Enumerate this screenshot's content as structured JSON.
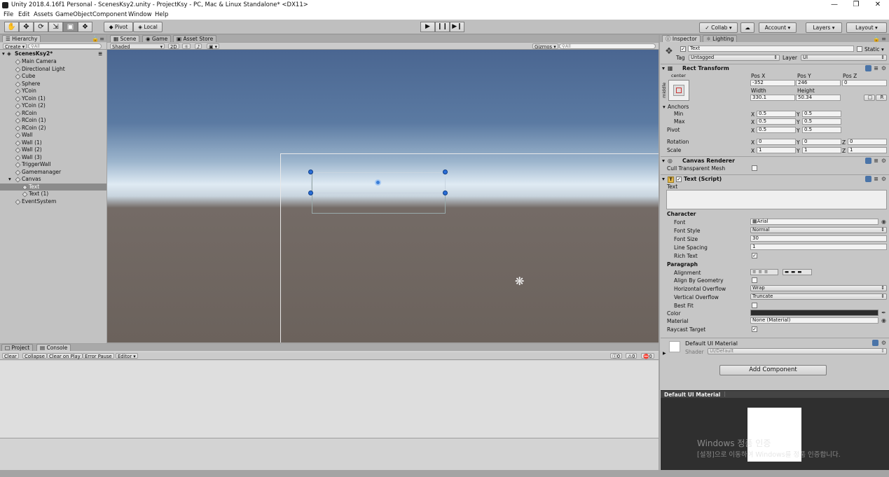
{
  "window": {
    "title": "Unity 2018.4.16f1 Personal - ScenesKsy2.unity - ProjectKsy - PC, Mac & Linux Standalone* <DX11>"
  },
  "menu": [
    "File",
    "Edit",
    "Assets",
    "GameObject",
    "Component",
    "Window",
    "Help"
  ],
  "toolbar": {
    "pivot": "Pivot",
    "local": "Local",
    "collab": "Collab",
    "account": "Account",
    "layers": "Layers",
    "layout": "Layout"
  },
  "hierarchy": {
    "tab": "Hierarchy",
    "create": "Create",
    "search_placeholder": "All",
    "scene": "ScenesKsy2*",
    "items": [
      "Main Camera",
      "Directional Light",
      "Cube",
      "Sphere",
      "YCoin",
      "YCoin (1)",
      "YCoin (2)",
      "RCoin",
      "RCoin (1)",
      "RCoin (2)",
      "Wall",
      "Wall (1)",
      "Wall (2)",
      "Wall (3)",
      "TriggerWall",
      "Gamemanager",
      "Canvas",
      "Text",
      "Text (1)",
      "EventSystem"
    ]
  },
  "scene_tabs": {
    "scene": "Scene",
    "game": "Game",
    "asset_store": "Asset Store",
    "shaded": "Shaded",
    "mode2d": "2D",
    "gizmos": "Gizmos",
    "search_placeholder": "All"
  },
  "console": {
    "project_tab": "Project",
    "console_tab": "Console",
    "clear": "Clear",
    "collapse": "Collapse",
    "clear_on_play": "Clear on Play",
    "error_pause": "Error Pause",
    "editor": "Editor",
    "count_info": "0",
    "count_warn": "0",
    "count_err": "0"
  },
  "inspector": {
    "tab": "Inspector",
    "lighting_tab": "Lighting",
    "name": "Text",
    "static": "Static",
    "tag_label": "Tag",
    "tag": "Untagged",
    "layer_label": "Layer",
    "layer": "UI",
    "rect_transform": "Rect Transform",
    "anchor_h": "center",
    "anchor_v": "middle",
    "posx_label": "Pos X",
    "posy_label": "Pos Y",
    "posz_label": "Pos Z",
    "posx": "-352",
    "posy": "246",
    "posz": "0",
    "width_label": "Width",
    "height_label": "Height",
    "width": "330.1",
    "height": "50.34",
    "r_btn": "R",
    "anchors": "Anchors",
    "min": "Min",
    "max": "Max",
    "pivot": "Pivot",
    "rotation": "Rotation",
    "scale": "Scale",
    "x": "X",
    "y": "Y",
    "z": "Z",
    "amin_x": "0.5",
    "amin_y": "0.5",
    "amax_x": "0.5",
    "amax_y": "0.5",
    "pivot_x": "0.5",
    "pivot_y": "0.5",
    "rot_x": "0",
    "rot_y": "0",
    "rot_z": "0",
    "scale_x": "1",
    "scale_y": "1",
    "scale_z": "1",
    "canvas_renderer": "Canvas Renderer",
    "cull": "Cull Transparent Mesh",
    "text_script": "Text (Script)",
    "text_label": "Text",
    "character": "Character",
    "font_label": "Font",
    "font": "Arial",
    "font_style_label": "Font Style",
    "font_style": "Normal",
    "font_size_label": "Font Size",
    "font_size": "30",
    "line_spacing_label": "Line Spacing",
    "line_spacing": "1",
    "rich_text": "Rich Text",
    "paragraph": "Paragraph",
    "alignment": "Alignment",
    "align_geom": "Align By Geometry",
    "h_overflow_label": "Horizontal Overflow",
    "h_overflow": "Wrap",
    "v_overflow_label": "Vertical Overflow",
    "v_overflow": "Truncate",
    "best_fit": "Best Fit",
    "color_label": "Color",
    "color": "#2d2d2d",
    "material_label": "Material",
    "material": "None (Material)",
    "raycast": "Raycast Target",
    "default_mat": "Default UI Material",
    "shader_label": "Shader",
    "shader": "UI/Default",
    "add_component": "Add Component",
    "preview_title": "Default UI Material"
  },
  "watermark": {
    "line1": "Windows 정품 인증",
    "line2": "[설정]으로 이동하여 Windows를 정품 인증합니다."
  }
}
